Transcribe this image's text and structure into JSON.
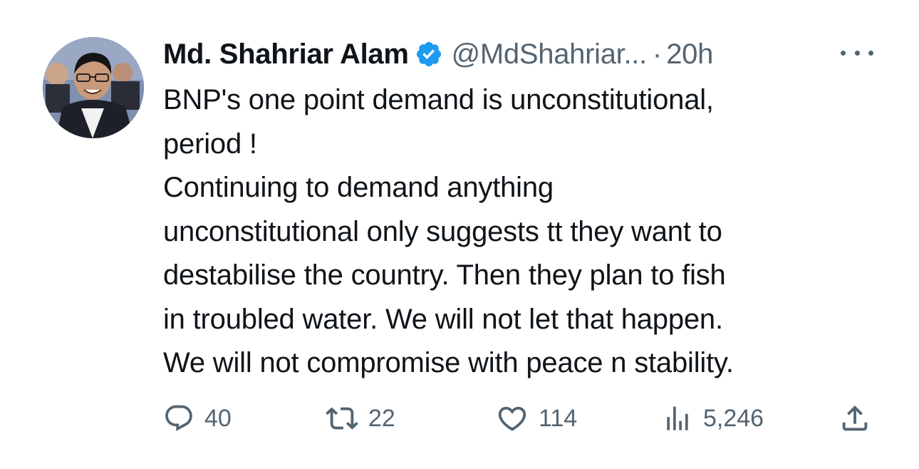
{
  "tweet": {
    "author": {
      "display_name": "Md. Shahriar Alam",
      "handle": "@MdShahriar...",
      "verified_icon": "verified-badge-icon",
      "avatar": "profile-photo"
    },
    "separator": "·",
    "time": "20h",
    "more_icon": "more-horizontal-icon",
    "text_lines": [
      "BNP's one point demand is unconstitutional,",
      "period !",
      "Continuing to demand anything",
      "unconstitutional only suggests tt they want to",
      "destabilise the country. Then they plan to fish",
      "in troubled water. We will not let that happen.",
      "We will not compromise with peace n stability."
    ],
    "actions": {
      "reply": {
        "icon": "reply-icon",
        "count": "40"
      },
      "retweet": {
        "icon": "retweet-icon",
        "count": "22"
      },
      "like": {
        "icon": "heart-icon",
        "count": "114"
      },
      "views": {
        "icon": "views-icon",
        "count": "5,246"
      },
      "share": {
        "icon": "share-icon"
      }
    }
  },
  "colors": {
    "text_primary": "#0f1419",
    "text_secondary": "#536471",
    "verified_blue": "#1d9bf0",
    "background": "#ffffff"
  }
}
